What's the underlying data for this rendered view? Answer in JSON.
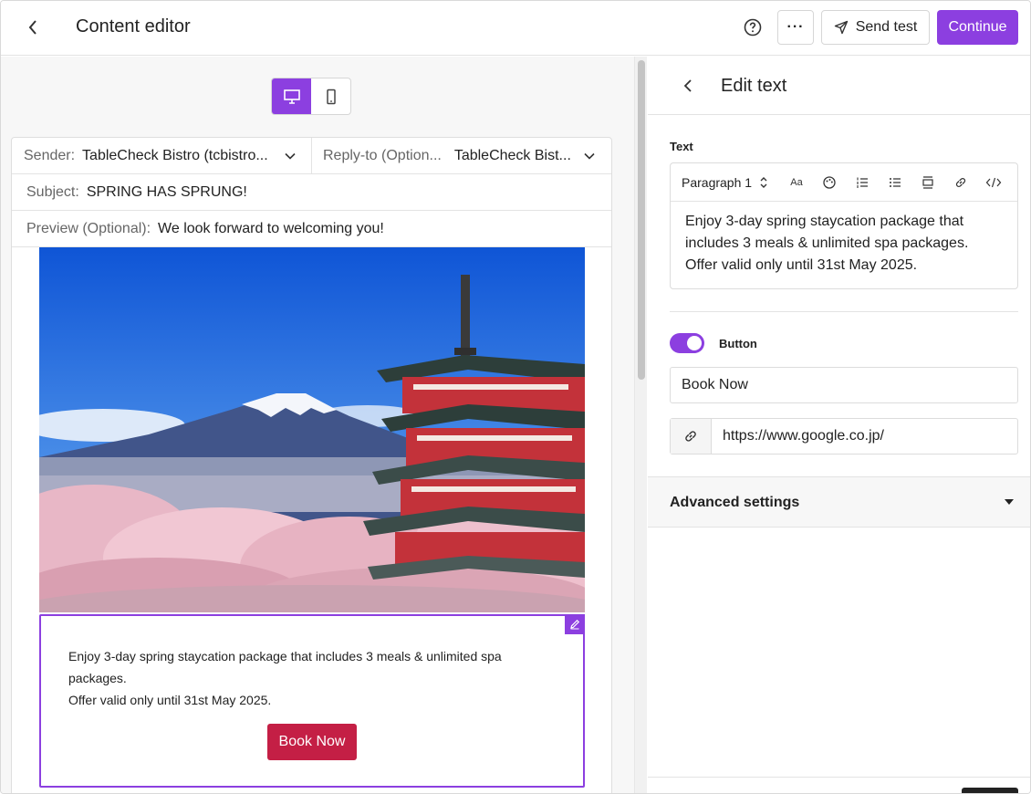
{
  "topbar": {
    "title": "Content editor",
    "send_test_label": "Send test",
    "continue_label": "Continue",
    "more_label": "···"
  },
  "email": {
    "sender_label": "Sender:",
    "sender_value": "TableCheck Bistro (tcbistro...",
    "reply_label": "Reply-to (Option...",
    "reply_value": "TableCheck Bist...",
    "subject_label": "Subject:",
    "subject_value": "SPRING HAS SPRUNG!",
    "preview_label": "Preview (Optional):",
    "preview_value": "We look forward to welcoming you!",
    "body_line1": "Enjoy 3-day spring staycation package that includes 3 meals & unlimited spa",
    "body_line2": "packages.",
    "body_line3": "Offer valid only until 31st May 2025.",
    "button_label": "Book Now"
  },
  "panel": {
    "title": "Edit text",
    "text_section": "Text",
    "paragraph_style": "Paragraph 1",
    "font_size_tool": "Aa",
    "content_line1": "Enjoy 3-day spring staycation package that",
    "content_line2": "includes 3 meals & unlimited spa packages.",
    "content_line3": "Offer valid only until 31st May 2025.",
    "button_section": "Button",
    "button_enabled": true,
    "button_text": "Book Now",
    "button_url": "https://www.google.co.jp/",
    "advanced_label": "Advanced settings"
  },
  "colors": {
    "accent": "#8c3fe0",
    "cta": "#c41f45"
  }
}
